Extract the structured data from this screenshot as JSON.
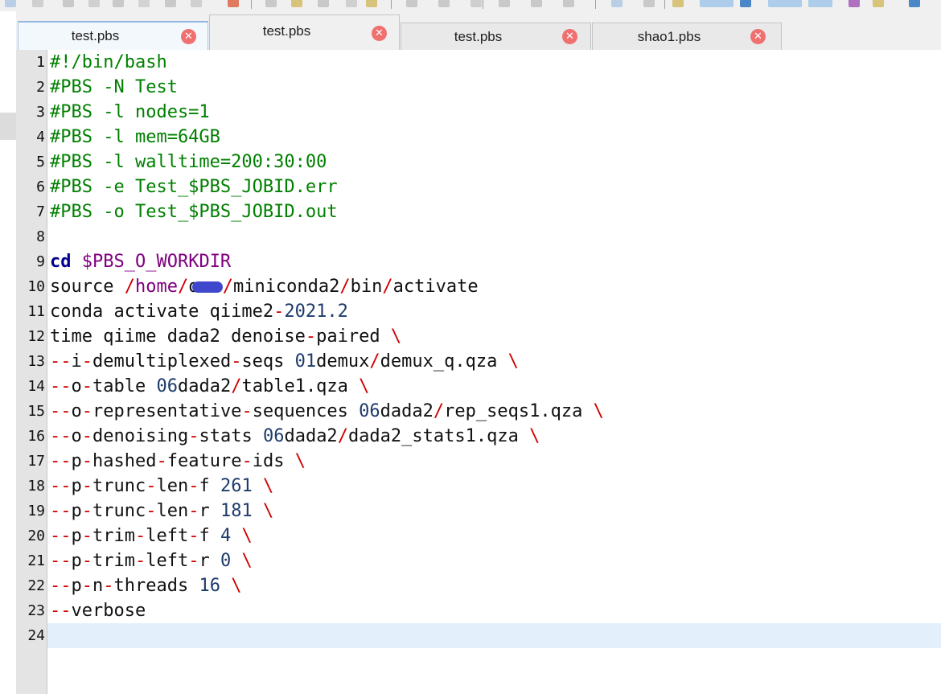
{
  "tabs": [
    {
      "label": "test.pbs",
      "state": "active"
    },
    {
      "label": "test.pbs",
      "state": "raised"
    },
    {
      "label": "test.pbs",
      "state": "normal"
    },
    {
      "label": "shao1.pbs",
      "state": "normal"
    }
  ],
  "close_glyph": "✕",
  "editor": {
    "current_line": 24,
    "lines": [
      {
        "n": "1",
        "tokens": [
          {
            "t": "#!/bin/bash",
            "c": "comment"
          }
        ]
      },
      {
        "n": "2",
        "tokens": [
          {
            "t": "#PBS -N Test",
            "c": "comment"
          }
        ]
      },
      {
        "n": "3",
        "tokens": [
          {
            "t": "#PBS -l nodes=1",
            "c": "comment"
          }
        ]
      },
      {
        "n": "4",
        "tokens": [
          {
            "t": "#PBS -l mem=64GB",
            "c": "comment"
          }
        ]
      },
      {
        "n": "5",
        "tokens": [
          {
            "t": "#PBS -l walltime=200:30:00",
            "c": "comment"
          }
        ]
      },
      {
        "n": "6",
        "tokens": [
          {
            "t": "#PBS -e Test_$PBS_JOBID.err",
            "c": "comment"
          }
        ]
      },
      {
        "n": "7",
        "tokens": [
          {
            "t": "#PBS -o Test_$PBS_JOBID.out",
            "c": "comment"
          }
        ]
      },
      {
        "n": "8",
        "tokens": []
      },
      {
        "n": "9",
        "tokens": [
          {
            "t": "cd",
            "c": "kw"
          },
          {
            "t": " ",
            "c": "txt"
          },
          {
            "t": "$PBS_O_WORKDIR",
            "c": "var"
          }
        ]
      },
      {
        "n": "10",
        "tokens": [
          {
            "t": "source ",
            "c": "txt"
          },
          {
            "t": "/",
            "c": "op"
          },
          {
            "t": "home",
            "c": "var"
          },
          {
            "t": "/",
            "c": "op"
          },
          {
            "t": "ou",
            "c": "txt"
          },
          {
            "t": "",
            "c": "redact"
          },
          {
            "t": "/",
            "c": "op"
          },
          {
            "t": "miniconda2",
            "c": "txt"
          },
          {
            "t": "/",
            "c": "op"
          },
          {
            "t": "bin",
            "c": "txt"
          },
          {
            "t": "/",
            "c": "op"
          },
          {
            "t": "activate",
            "c": "txt"
          }
        ]
      },
      {
        "n": "11",
        "tokens": [
          {
            "t": "conda activate qiime2",
            "c": "txt"
          },
          {
            "t": "-",
            "c": "op"
          },
          {
            "t": "2021.2",
            "c": "num"
          }
        ]
      },
      {
        "n": "12",
        "tokens": [
          {
            "t": "time qiime dada2 denoise",
            "c": "txt"
          },
          {
            "t": "-",
            "c": "op"
          },
          {
            "t": "paired ",
            "c": "txt"
          },
          {
            "t": "\\",
            "c": "op"
          }
        ]
      },
      {
        "n": "13",
        "tokens": [
          {
            "t": "--",
            "c": "op"
          },
          {
            "t": "i",
            "c": "txt"
          },
          {
            "t": "-",
            "c": "op"
          },
          {
            "t": "demultiplexed",
            "c": "txt"
          },
          {
            "t": "-",
            "c": "op"
          },
          {
            "t": "seqs ",
            "c": "txt"
          },
          {
            "t": "01",
            "c": "num"
          },
          {
            "t": "demux",
            "c": "txt"
          },
          {
            "t": "/",
            "c": "op"
          },
          {
            "t": "demux_q.qza ",
            "c": "txt"
          },
          {
            "t": "\\",
            "c": "op"
          }
        ]
      },
      {
        "n": "14",
        "tokens": [
          {
            "t": "--",
            "c": "op"
          },
          {
            "t": "o",
            "c": "txt"
          },
          {
            "t": "-",
            "c": "op"
          },
          {
            "t": "table ",
            "c": "txt"
          },
          {
            "t": "06",
            "c": "num"
          },
          {
            "t": "dada2",
            "c": "txt"
          },
          {
            "t": "/",
            "c": "op"
          },
          {
            "t": "table1.qza ",
            "c": "txt"
          },
          {
            "t": "\\",
            "c": "op"
          }
        ]
      },
      {
        "n": "15",
        "tokens": [
          {
            "t": "--",
            "c": "op"
          },
          {
            "t": "o",
            "c": "txt"
          },
          {
            "t": "-",
            "c": "op"
          },
          {
            "t": "representative",
            "c": "txt"
          },
          {
            "t": "-",
            "c": "op"
          },
          {
            "t": "sequences ",
            "c": "txt"
          },
          {
            "t": "06",
            "c": "num"
          },
          {
            "t": "dada2",
            "c": "txt"
          },
          {
            "t": "/",
            "c": "op"
          },
          {
            "t": "rep_seqs1.qza ",
            "c": "txt"
          },
          {
            "t": "\\",
            "c": "op"
          }
        ]
      },
      {
        "n": "16",
        "tokens": [
          {
            "t": "--",
            "c": "op"
          },
          {
            "t": "o",
            "c": "txt"
          },
          {
            "t": "-",
            "c": "op"
          },
          {
            "t": "denoising",
            "c": "txt"
          },
          {
            "t": "-",
            "c": "op"
          },
          {
            "t": "stats ",
            "c": "txt"
          },
          {
            "t": "06",
            "c": "num"
          },
          {
            "t": "dada2",
            "c": "txt"
          },
          {
            "t": "/",
            "c": "op"
          },
          {
            "t": "dada2_stats1.qza ",
            "c": "txt"
          },
          {
            "t": "\\",
            "c": "op"
          }
        ]
      },
      {
        "n": "17",
        "tokens": [
          {
            "t": "--",
            "c": "op"
          },
          {
            "t": "p",
            "c": "txt"
          },
          {
            "t": "-",
            "c": "op"
          },
          {
            "t": "hashed",
            "c": "txt"
          },
          {
            "t": "-",
            "c": "op"
          },
          {
            "t": "feature",
            "c": "txt"
          },
          {
            "t": "-",
            "c": "op"
          },
          {
            "t": "ids ",
            "c": "txt"
          },
          {
            "t": "\\",
            "c": "op"
          }
        ]
      },
      {
        "n": "18",
        "tokens": [
          {
            "t": "--",
            "c": "op"
          },
          {
            "t": "p",
            "c": "txt"
          },
          {
            "t": "-",
            "c": "op"
          },
          {
            "t": "trunc",
            "c": "txt"
          },
          {
            "t": "-",
            "c": "op"
          },
          {
            "t": "len",
            "c": "txt"
          },
          {
            "t": "-",
            "c": "op"
          },
          {
            "t": "f ",
            "c": "txt"
          },
          {
            "t": "261",
            "c": "num"
          },
          {
            "t": " ",
            "c": "txt"
          },
          {
            "t": "\\",
            "c": "op"
          }
        ]
      },
      {
        "n": "19",
        "tokens": [
          {
            "t": "--",
            "c": "op"
          },
          {
            "t": "p",
            "c": "txt"
          },
          {
            "t": "-",
            "c": "op"
          },
          {
            "t": "trunc",
            "c": "txt"
          },
          {
            "t": "-",
            "c": "op"
          },
          {
            "t": "len",
            "c": "txt"
          },
          {
            "t": "-",
            "c": "op"
          },
          {
            "t": "r ",
            "c": "txt"
          },
          {
            "t": "181",
            "c": "num"
          },
          {
            "t": " ",
            "c": "txt"
          },
          {
            "t": "\\",
            "c": "op"
          }
        ]
      },
      {
        "n": "20",
        "tokens": [
          {
            "t": "--",
            "c": "op"
          },
          {
            "t": "p",
            "c": "txt"
          },
          {
            "t": "-",
            "c": "op"
          },
          {
            "t": "trim",
            "c": "txt"
          },
          {
            "t": "-",
            "c": "op"
          },
          {
            "t": "left",
            "c": "txt"
          },
          {
            "t": "-",
            "c": "op"
          },
          {
            "t": "f ",
            "c": "txt"
          },
          {
            "t": "4",
            "c": "num"
          },
          {
            "t": " ",
            "c": "txt"
          },
          {
            "t": "\\",
            "c": "op"
          }
        ]
      },
      {
        "n": "21",
        "tokens": [
          {
            "t": "--",
            "c": "op"
          },
          {
            "t": "p",
            "c": "txt"
          },
          {
            "t": "-",
            "c": "op"
          },
          {
            "t": "trim",
            "c": "txt"
          },
          {
            "t": "-",
            "c": "op"
          },
          {
            "t": "left",
            "c": "txt"
          },
          {
            "t": "-",
            "c": "op"
          },
          {
            "t": "r ",
            "c": "txt"
          },
          {
            "t": "0",
            "c": "num"
          },
          {
            "t": " ",
            "c": "txt"
          },
          {
            "t": "\\",
            "c": "op"
          }
        ]
      },
      {
        "n": "22",
        "tokens": [
          {
            "t": "--",
            "c": "op"
          },
          {
            "t": "p",
            "c": "txt"
          },
          {
            "t": "-",
            "c": "op"
          },
          {
            "t": "n",
            "c": "txt"
          },
          {
            "t": "-",
            "c": "op"
          },
          {
            "t": "threads ",
            "c": "txt"
          },
          {
            "t": "16",
            "c": "num"
          },
          {
            "t": " ",
            "c": "txt"
          },
          {
            "t": "\\",
            "c": "op"
          }
        ]
      },
      {
        "n": "23",
        "tokens": [
          {
            "t": "--",
            "c": "op"
          },
          {
            "t": "verbose",
            "c": "txt"
          }
        ]
      },
      {
        "n": "24",
        "tokens": []
      }
    ]
  },
  "colors": {
    "comment": "#008000",
    "keyword": "#00008b",
    "variable": "#800080",
    "operator": "#d00000",
    "number": "#1d3b6b",
    "current_line_bg": "#e3effb",
    "close_button": "#f07070"
  }
}
